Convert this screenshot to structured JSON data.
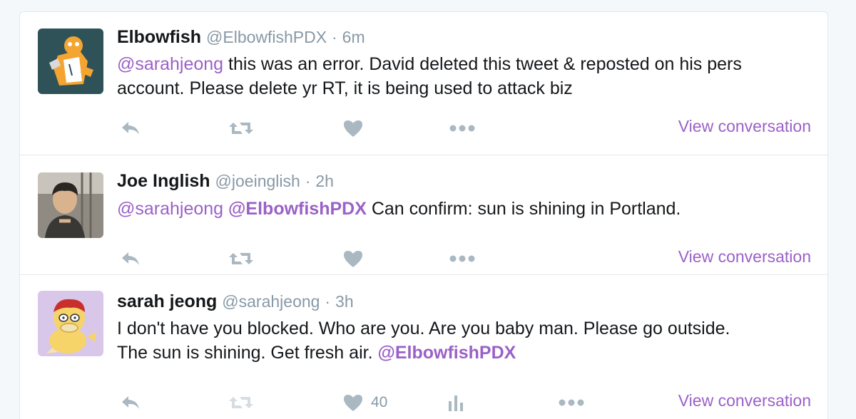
{
  "tweets": [
    {
      "name": "Elbowfish",
      "handle": "@ElbowfishPDX",
      "separator": "·",
      "time": "6m",
      "text_mention": "@sarahjeong",
      "text_line1": " this was an error. David deleted this tweet & reposted on his pers",
      "text_line2": "account. Please delete yr RT, it is being used to attack biz",
      "view_conversation": "View conversation"
    },
    {
      "name": "Joe Inglish",
      "handle": "@joeinglish",
      "separator": "·",
      "time": "2h",
      "text_mention1": "@sarahjeong",
      "text_mention2": "@ElbowfishPDX",
      "text_body": " Can confirm: sun is shining in Portland.",
      "view_conversation": "View conversation"
    },
    {
      "name": "sarah jeong",
      "handle": "@sarahjeong",
      "separator": "·",
      "time": "3h",
      "text_line1": "I don't have you blocked. Who are you. Are you baby man. Please go outside.",
      "text_line2": "The sun is shining. Get fresh air. ",
      "text_mention": "@ElbowfishPDX",
      "like_count": "40",
      "view_conversation": "View conversation"
    }
  ],
  "colors": {
    "accent": "#9a61c7",
    "muted": "#8899a6",
    "icon": "#aab8c2",
    "border": "#e1e8ed"
  },
  "icons": [
    "reply-icon",
    "retweet-icon",
    "heart-icon",
    "more-icon",
    "analytics-icon"
  ]
}
